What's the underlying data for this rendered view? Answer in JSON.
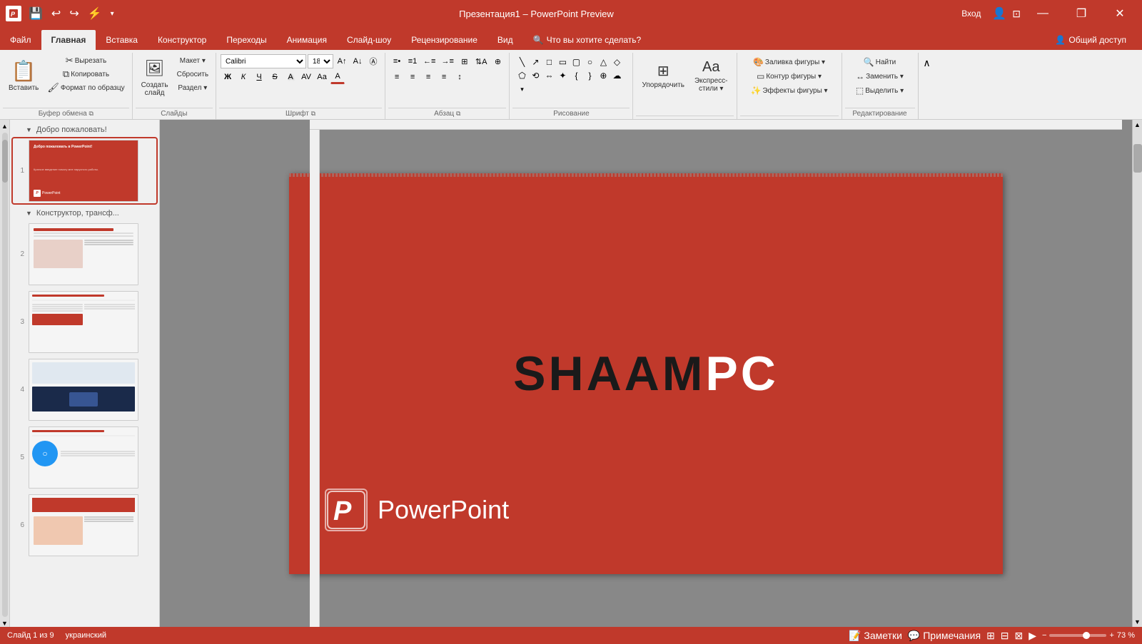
{
  "titlebar": {
    "app_title": "Презентация1",
    "preview_label": "PowerPoint Preview",
    "separator": "–",
    "login_btn": "Вход",
    "minimize": "—",
    "maximize": "❐",
    "close": "✕",
    "quick_btns": [
      "💾",
      "↩",
      "↪",
      "⚡",
      "▾"
    ]
  },
  "ribbon": {
    "tabs": [
      "Файл",
      "Главная",
      "Вставка",
      "Конструктор",
      "Переходы",
      "Анимация",
      "Слайд-шоу",
      "Рецензирование",
      "Вид",
      "🔍 Что вы хотите сделать?"
    ],
    "active_tab": "Главная",
    "groups": {
      "clipboard": {
        "label": "Буфер обмена",
        "paste_label": "Вставить",
        "cut_label": "Вырезать",
        "copy_label": "Копировать",
        "format_label": "Формат по образцу"
      },
      "slides": {
        "label": "Слайды",
        "new_label": "Создать\nслайд",
        "layout_label": "Макет ▾",
        "reset_label": "Сбросить",
        "section_label": "Раздел ▾"
      },
      "font": {
        "label": "Шрифт",
        "font_name": "Calibri",
        "font_size": "18",
        "grow": "A↑",
        "shrink": "A↓",
        "clear": "A✕",
        "bold": "Ж",
        "italic": "К",
        "underline": "Ч",
        "strikethrough": "S",
        "shadow": "А",
        "spacing": "AV",
        "case": "Аа",
        "color": "А"
      },
      "paragraph": {
        "label": "Абзац",
        "bullets": "≡",
        "numbers": "≡#",
        "decrease": "←≡",
        "increase": "→≡",
        "align_left": "≡",
        "align_center": "≡",
        "align_right": "≡",
        "justify": "≡",
        "columns": "⊞",
        "direction": "⇅",
        "smartart": "⊕"
      },
      "drawing": {
        "label": "Рисование",
        "tools": [
          "\\",
          "/",
          "□",
          "○",
          "△",
          "◇",
          "⬡",
          "→",
          "⇒",
          "⟲",
          "⇔",
          "✦",
          "{",
          "}",
          "⊕",
          "☆"
        ]
      },
      "arrange": {
        "label": "Упорядочить",
        "arrange_label": "Упорядочить"
      },
      "quick_styles": {
        "label": "Экспресс-стили ▾"
      },
      "shape_fill": {
        "label": "Заливка фигуры ▾"
      },
      "shape_outline": {
        "label": "Контур фигуры ▾"
      },
      "shape_effects": {
        "label": "Эффекты фигуры ▾"
      },
      "editing": {
        "label": "Редактирование",
        "find_label": "Найти",
        "replace_label": "Заменить ▾",
        "select_label": "Выделить ▾"
      }
    }
  },
  "sidebar": {
    "sections": [
      {
        "label": "Добро пожаловать!",
        "slides": [
          {
            "number": "1",
            "type": "welcome"
          }
        ]
      },
      {
        "label": "Конструктор, трансф...",
        "slides": [
          {
            "number": "2",
            "type": "content1"
          },
          {
            "number": "3",
            "type": "content2"
          },
          {
            "number": "4",
            "type": "content3"
          },
          {
            "number": "5",
            "type": "content4"
          },
          {
            "number": "6",
            "type": "content5"
          }
        ]
      }
    ]
  },
  "canvas": {
    "slide_brand_black": "SHAAM",
    "slide_brand_white": "PC",
    "pp_logo_letter": "P",
    "pp_name": "PowerPoint",
    "bg_color": "#c0392b"
  },
  "statusbar": {
    "slide_info": "Слайд 1 из 9",
    "language": "украинский",
    "notes_btn": "Заметки",
    "comments_btn": "Примечания",
    "zoom_level": "73 %",
    "zoom_minus": "−",
    "zoom_plus": "+"
  }
}
